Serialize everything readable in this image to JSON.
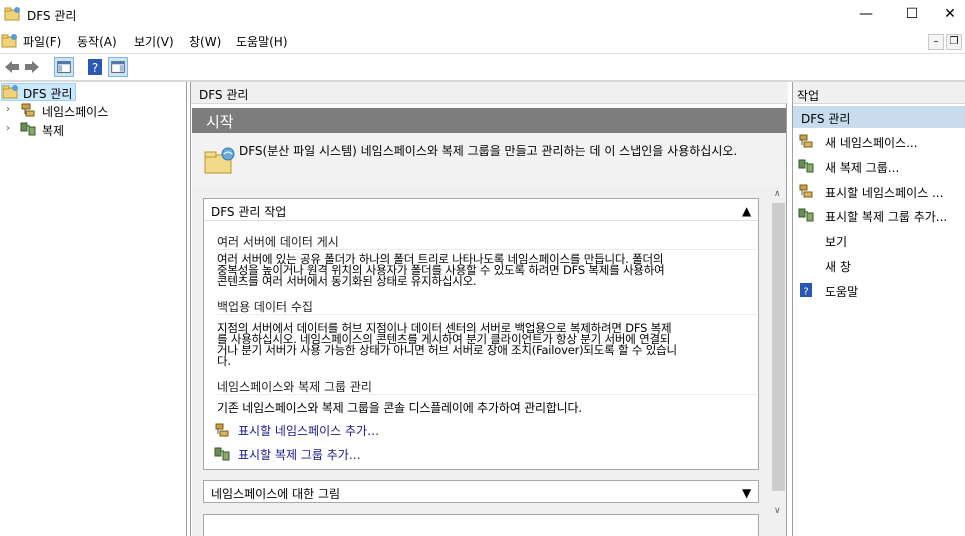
{
  "window": {
    "title": "DFS 관리",
    "minimize": "—",
    "maximize": "☐",
    "close": "✕"
  },
  "menu": {
    "items": [
      "파일(F)",
      "동작(A)",
      "보기(V)",
      "창(W)",
      "도움말(H)"
    ],
    "mdi_buttons": [
      "–",
      "❐"
    ]
  },
  "toolbar": {
    "icons": [
      "back-icon",
      "forward-icon",
      "show-hide-console-tree-icon",
      "help-icon",
      "show-hide-action-pane-icon"
    ]
  },
  "tree": {
    "root": "DFS 관리",
    "children": [
      "네임스페이스",
      "복제"
    ]
  },
  "center": {
    "header": "DFS 관리",
    "banner": "시작",
    "intro": "DFS(분산 파일 시스템) 네임스페이스와 복제 그룹을 만들고 관리하는 데 이 스냅인을 사용하십시오.",
    "panel_title": "DFS 관리 작업",
    "sections": [
      {
        "title": "여러 서버에 데이터 게시",
        "lines": [
          "여러 서버에 있는 공유 폴더가 하나의 폴더 트리로 나타나도록 네임스페이스를 만듭니다. 폴더의",
          "중복성을 높이거나 원격 위치의 사용자가 폴더를 사용할 수 있도록 하려면 DFS 복제를 사용하여",
          "콘텐츠를 여러 서버에서 동기화된 상태로 유지하십시오."
        ]
      },
      {
        "title": "백업용 데이터 수집",
        "lines": [
          "지점의 서버에서 데이터를 허브 지점이나 데이터 센터의 서버로 백업용으로 복제하려면 DFS 복제",
          "를 사용하십시오. 네임스페이스의 콘텐츠를 게시하여 분기 클라이언트가 항상 분기 서버에 연결되",
          "거나 분기 서버가 사용 가능한 상태가 아니면 허브 서버로 장애 조치(Failover)되도록 할 수 있습니",
          "다."
        ]
      },
      {
        "title": "네임스페이스와 복제 그룹 관리",
        "lines": [
          "기존 네임스페이스와 복제 그룹을 콘솔 디스플레이에 추가하여 관리합니다."
        ]
      }
    ],
    "links": [
      "표시할 네임스페이스 추가…",
      "표시할 복제 그룹 추가…"
    ],
    "panel2_title": "네임스페이스에 대한 그림",
    "collapse_arrow": "▲",
    "expand_arrow": "▼"
  },
  "actions": {
    "header": "작업",
    "group": "DFS 관리",
    "items": [
      {
        "label": "새 네임스페이스...",
        "icon": "new-namespace-icon"
      },
      {
        "label": "새 복제 그룹...",
        "icon": "new-replication-group-icon"
      },
      {
        "label": "표시할 네임스페이스 ...",
        "icon": "add-namespace-display-icon"
      },
      {
        "label": "표시할 복제 그룹 추가...",
        "icon": "add-replication-display-icon"
      },
      {
        "label": "보기",
        "icon": ""
      },
      {
        "label": "새 창",
        "icon": ""
      },
      {
        "label": "도움말",
        "icon": "help-icon"
      }
    ]
  },
  "colors": {
    "banner": "#7d7d7d",
    "selection": "#cce8ff",
    "action_group": "#c8dcee",
    "link": "#1a1a8a"
  }
}
